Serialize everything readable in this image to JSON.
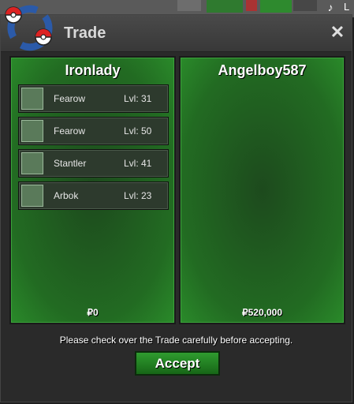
{
  "window": {
    "title": "Trade",
    "close_icon": "close-icon"
  },
  "left_player": {
    "name": "Ironlady",
    "money": "₽0",
    "pokemon": [
      {
        "name": "Fearow",
        "level": "Lvl: 31",
        "icon": "fearow-icon"
      },
      {
        "name": "Fearow",
        "level": "Lvl: 50",
        "icon": "fearow-icon"
      },
      {
        "name": "Stantler",
        "level": "Lvl: 41",
        "icon": "stantler-icon"
      },
      {
        "name": "Arbok",
        "level": "Lvl: 23",
        "icon": "arbok-icon"
      }
    ]
  },
  "right_player": {
    "name": "Angelboy587",
    "money": "₽520,000",
    "pokemon": []
  },
  "notice": "Please check over the Trade carefully before accepting.",
  "accept_label": "Accept",
  "corner_letter": "L"
}
